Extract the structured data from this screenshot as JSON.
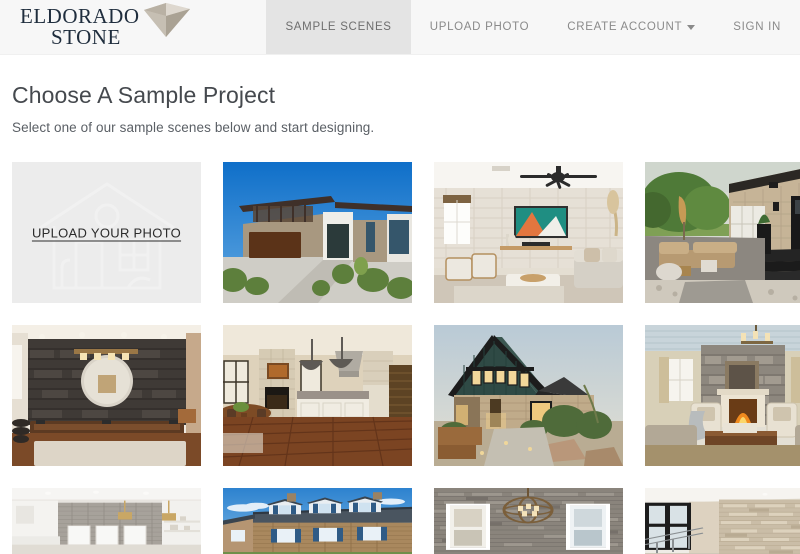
{
  "brand": {
    "word_top": "ELDORADO",
    "word_bottom": "STONE",
    "trademark": "®",
    "gem_color": "#c9c1b6",
    "text_color": "#1f2d3d"
  },
  "nav": {
    "items": [
      {
        "label": "SAMPLE SCENES",
        "active": true,
        "has_caret": false
      },
      {
        "label": "UPLOAD PHOTO",
        "active": false,
        "has_caret": false
      },
      {
        "label": "CREATE ACCOUNT",
        "active": false,
        "has_caret": true
      },
      {
        "label": "SIGN IN",
        "active": false,
        "has_caret": false
      }
    ],
    "active_bg": "#e4e4e4",
    "header_bg": "#f7f7f7"
  },
  "page": {
    "title": "Choose A Sample Project",
    "subtitle": "Select one of our sample scenes below and start designing."
  },
  "upload_tile": {
    "label": "UPLOAD YOUR PHOTO",
    "icon": "house-outline-icon",
    "background": "#ececec"
  },
  "scenes": [
    {
      "name": "modern-home-exterior",
      "description": "Modern two-story home exterior with stone veneer, brown garage door and blue sky",
      "sky": "#1f7fd4",
      "stone": "#b6a692",
      "accent": "#6b3c21"
    },
    {
      "name": "white-stone-living-room",
      "description": "Living room with white stacked stone accent wall, black ceiling fan and mounted TV",
      "sky": "#f2efe9",
      "stone": "#e8e3da",
      "accent": "#2e2e2e"
    },
    {
      "name": "stone-patio-exterior",
      "description": "Outdoor patio with tan stone house, black door and steps, wicker seating and trees",
      "sky": "#cfd9c8",
      "stone": "#cbbda4",
      "accent": "#22201e"
    },
    {
      "name": "dark-stone-game-room",
      "description": "Game room with dark stacked stone wall, round mirror, linear light and pool table",
      "sky": "#efece7",
      "stone": "#4a4440",
      "accent": "#5b3620"
    },
    {
      "name": "open-kitchen-great-room",
      "description": "Open kitchen and great room with white island, dark pendants, wood floors and stone fireplace",
      "sky": "#e9dfcf",
      "stone": "#d8cbb6",
      "accent": "#7a4a24"
    },
    {
      "name": "farmhouse-exterior-dusk",
      "description": "Modern farmhouse with dark green board-and-batten siding and tan stone base at dusk",
      "sky": "#c9d4dc",
      "stone": "#c2ad8e",
      "accent": "#2f4a45"
    },
    {
      "name": "traditional-fireplace-room",
      "description": "Traditional living room with gray stone fireplace wall, chandelier and cream armchairs",
      "sky": "#e3e6e9",
      "stone": "#9a948c",
      "accent": "#b8a98c"
    },
    {
      "name": "gray-brick-kitchen",
      "description": "Bright kitchen with gray brick wall, white cabinets, pendant lights and open shelving",
      "sky": "#f4f3f1",
      "stone": "#a6a29c",
      "accent": "#c8a96a"
    },
    {
      "name": "colonial-stone-house",
      "description": "Colonial stone house with dormer windows, blue shutters and blue sky",
      "sky": "#3f8fd6",
      "stone": "#a8855f",
      "accent": "#2c4a6e"
    },
    {
      "name": "gray-stone-dining-wall",
      "description": "Gray ledge stone wall with orb chandelier flanked by two windows",
      "sky": "#efefee",
      "stone": "#868079",
      "accent": "#7a5c3a"
    },
    {
      "name": "light-stone-entry-wall",
      "description": "Light stacked stone wall with black framed windows and staircase railing",
      "sky": "#f0ece6",
      "stone": "#c8bca9",
      "accent": "#1d1d1d"
    }
  ]
}
